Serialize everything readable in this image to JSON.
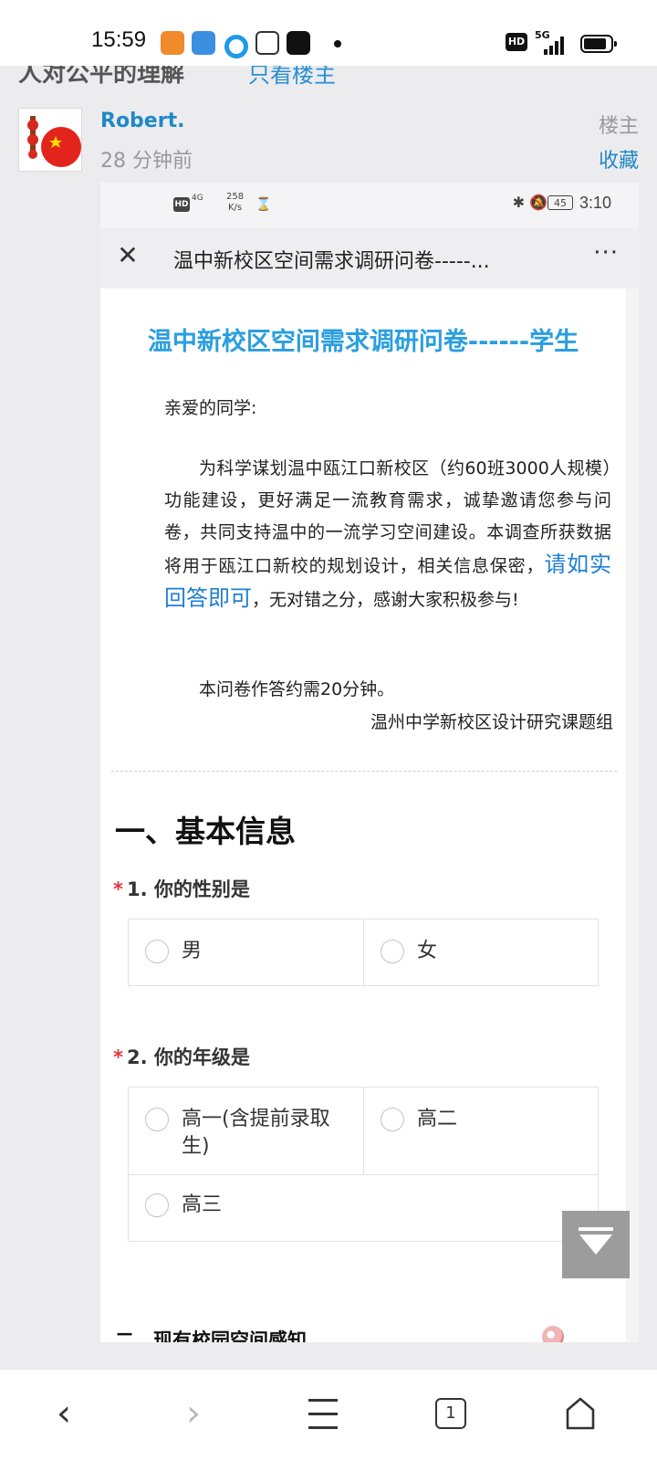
{
  "status_bar": {
    "time": "15:59",
    "hd": "HD",
    "network": "5G"
  },
  "forum": {
    "thread_title": "人对公平的理解",
    "only_owner_link": "只看楼主",
    "post": {
      "username": "Robert.",
      "time": "28 分钟前",
      "owner_badge": "楼主",
      "collect_label": "收藏"
    }
  },
  "embedded": {
    "status": {
      "hd": "HD",
      "network": "4G",
      "speed_value": "258",
      "speed_unit": "K/s",
      "battery": "45",
      "time": "3:10"
    },
    "nav": {
      "close_glyph": "✕",
      "title": "温中新校区空间需求调研问卷-----...",
      "more_glyph": "···"
    },
    "survey": {
      "title": "温中新校区空间需求调研问卷------学生",
      "greeting": "亲爱的同学:",
      "intro_part1": "为科学谋划温中瓯江口新校区（约60班3000人规模）功能建设，更好满足一流教育需求，诚挚邀请您参与问卷，共同支持温中的一流学习空间建设。本调查所获数据将用于瓯江口新校的规划设计，相关信息保密，",
      "intro_highlight": "请如实回答即可",
      "intro_part2": "，无对错之分，感谢大家积极参与!",
      "duration_note": "本问卷作答约需20分钟。",
      "signature": "温州中学新校区设计研究课题组",
      "section1_title": "一、基本信息",
      "q1": {
        "required_mark": "*",
        "label": "1. 你的性别是",
        "options": [
          "男",
          "女"
        ]
      },
      "q2": {
        "required_mark": "*",
        "label": "2. 你的年级是",
        "options": [
          "高一(含提前录取生)",
          "高二",
          "高三"
        ]
      },
      "section2_title": "二、现有校园空间感知"
    }
  },
  "bottom_bar": {
    "back_glyph": "‹",
    "forward_glyph": "›",
    "tab_count": "1"
  },
  "colors": {
    "link_blue": "#1f88c7",
    "survey_title_blue": "#2a9ee0",
    "required_red": "#e0383e"
  }
}
